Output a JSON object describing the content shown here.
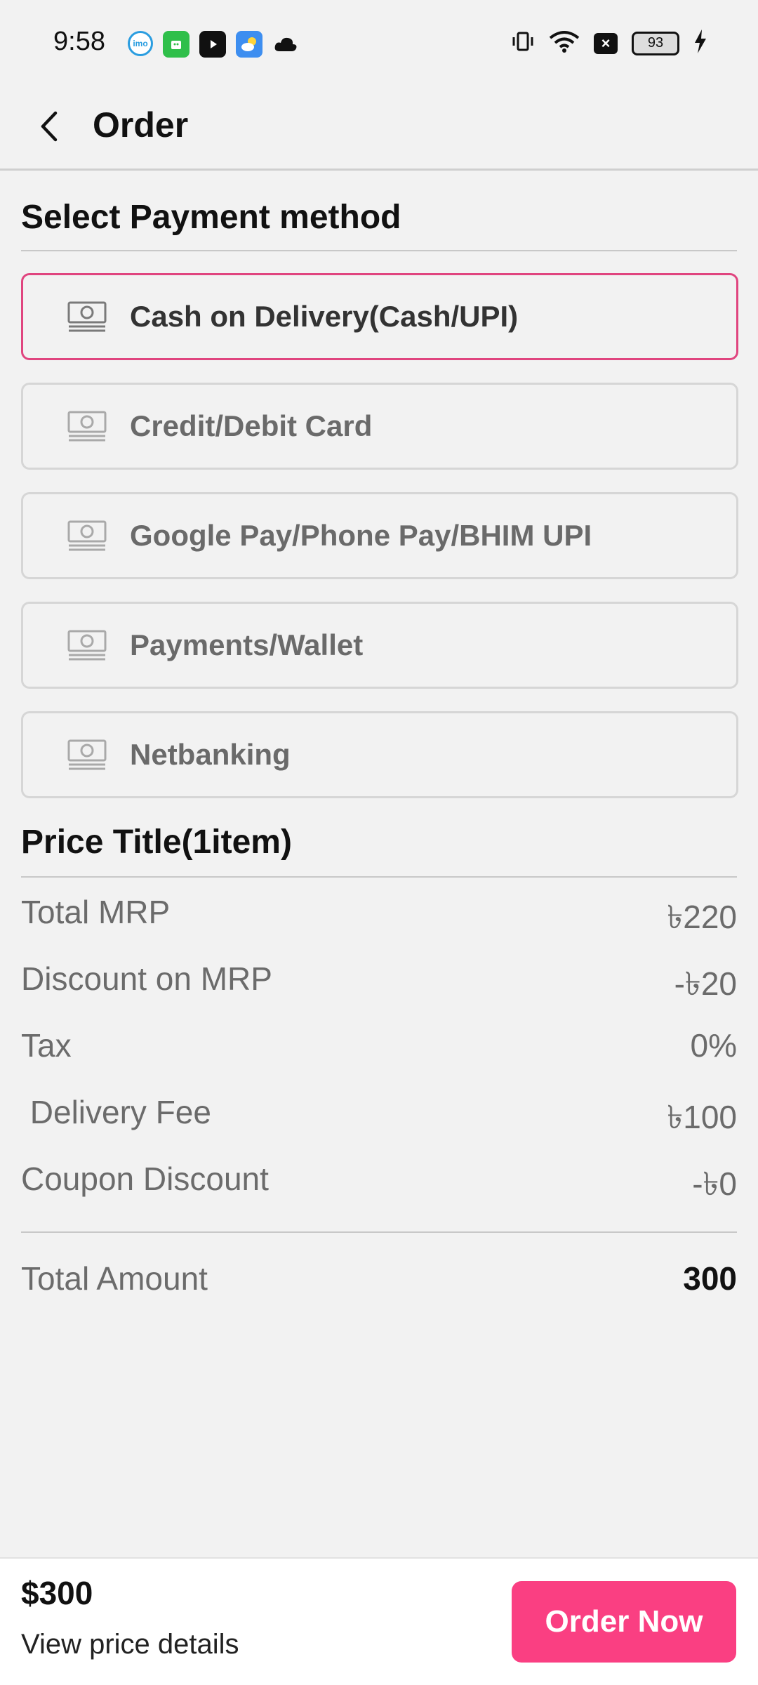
{
  "status_bar": {
    "time": "9:58",
    "notification_icons": [
      "imo-icon",
      "app-green-icon",
      "youtube-icon",
      "weather-icon",
      "cloud-icon"
    ],
    "imo_text": "imo",
    "battery": "93"
  },
  "header": {
    "title": "Order"
  },
  "payment": {
    "section_title": "Select Payment method",
    "options": [
      {
        "label": "Cash on Delivery(Cash/UPI)",
        "selected": true
      },
      {
        "label": "Credit/Debit Card",
        "selected": false
      },
      {
        "label": "Google Pay/Phone Pay/BHIM UPI",
        "selected": false
      },
      {
        "label": "Payments/Wallet",
        "selected": false
      },
      {
        "label": "Netbanking",
        "selected": false
      }
    ]
  },
  "price": {
    "section_title": "Price Title(1item)",
    "rows": [
      {
        "label": "Total MRP",
        "value": "৳220"
      },
      {
        "label": "Discount on MRP",
        "value": "-৳20"
      },
      {
        "label": "Tax",
        "value": "0%"
      },
      {
        "label": " Delivery Fee",
        "value": "৳100"
      },
      {
        "label": "Coupon Discount",
        "value": "-৳0"
      }
    ],
    "total_label": "Total Amount",
    "total_value": "300"
  },
  "bottom_bar": {
    "price": "$300",
    "details_link": "View price details",
    "order_button": "Order Now"
  },
  "colors": {
    "accent": "#fa3f82",
    "selected_border": "#e0457f",
    "background": "#f2f2f2"
  }
}
